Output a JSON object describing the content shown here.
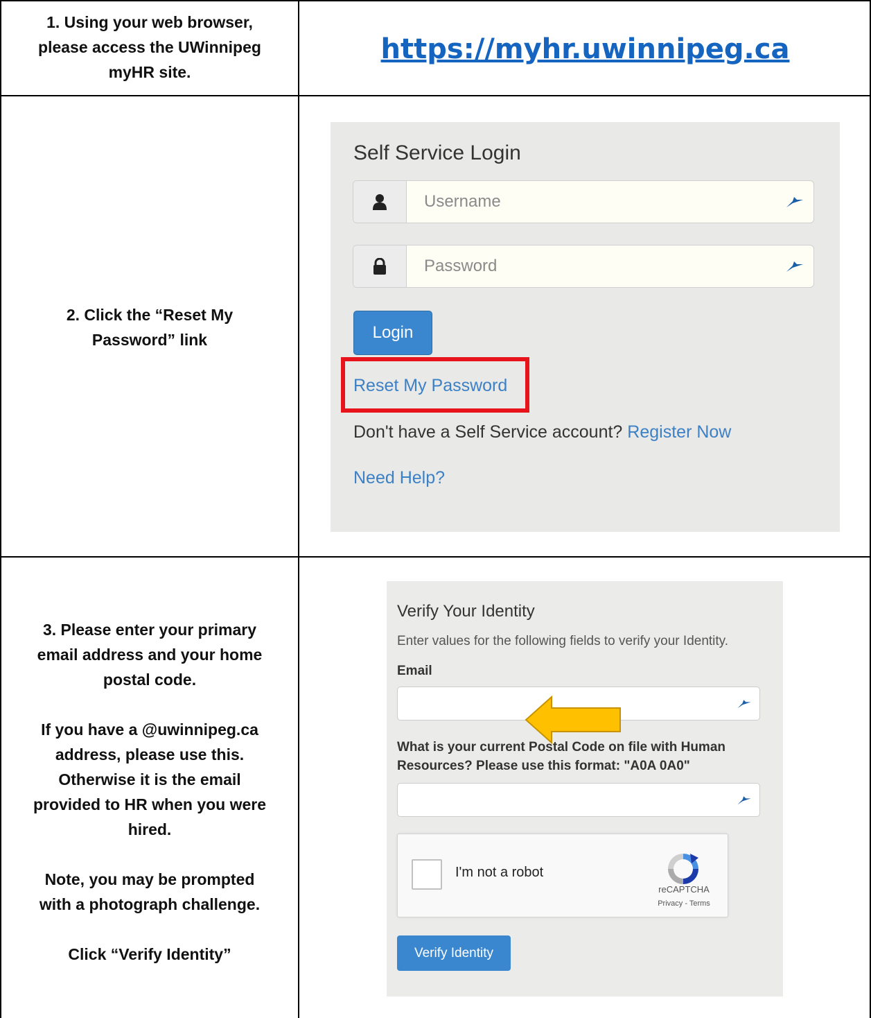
{
  "rows": [
    {
      "step_lines": [
        "1. Using your web browser,",
        "please access the UWinnipeg",
        "myHR site."
      ],
      "url": "https://myhr.uwinnipeg.ca"
    },
    {
      "step_lines": [
        "2. Click the “Reset My",
        "Password” link"
      ]
    },
    {
      "step_lines": [
        "3. Please enter your primary",
        "email address and your home",
        "postal code.",
        "",
        "If you have a @uwinnipeg.ca",
        "address, please use this.",
        "Otherwise it is the email",
        "provided to HR when you were",
        "hired.",
        "",
        "Note, you may be prompted",
        "with a photograph challenge.",
        "",
        "Click “Verify Identity”"
      ]
    }
  ],
  "login": {
    "title": "Self Service Login",
    "username_placeholder": "Username",
    "password_placeholder": "Password",
    "login_button": "Login",
    "reset_link": "Reset My Password",
    "register_prompt": "Don't have a Self Service account?",
    "register_link": "Register Now",
    "help_link": "Need Help?",
    "highlight_color": "#e8141c"
  },
  "verify": {
    "title": "Verify Your Identity",
    "description": "Enter values for the following fields to verify your Identity.",
    "email_label": "Email",
    "postal_label_lines": [
      "What is your current Postal Code on file with Human",
      "Resources? Please use this format: \"A0A 0A0\""
    ],
    "captcha_label": "I'm not a robot",
    "captcha_brand": "reCAPTCHA",
    "captcha_terms": "Privacy - Terms",
    "verify_button": "Verify Identity",
    "arrow_color": "#ffc000"
  }
}
